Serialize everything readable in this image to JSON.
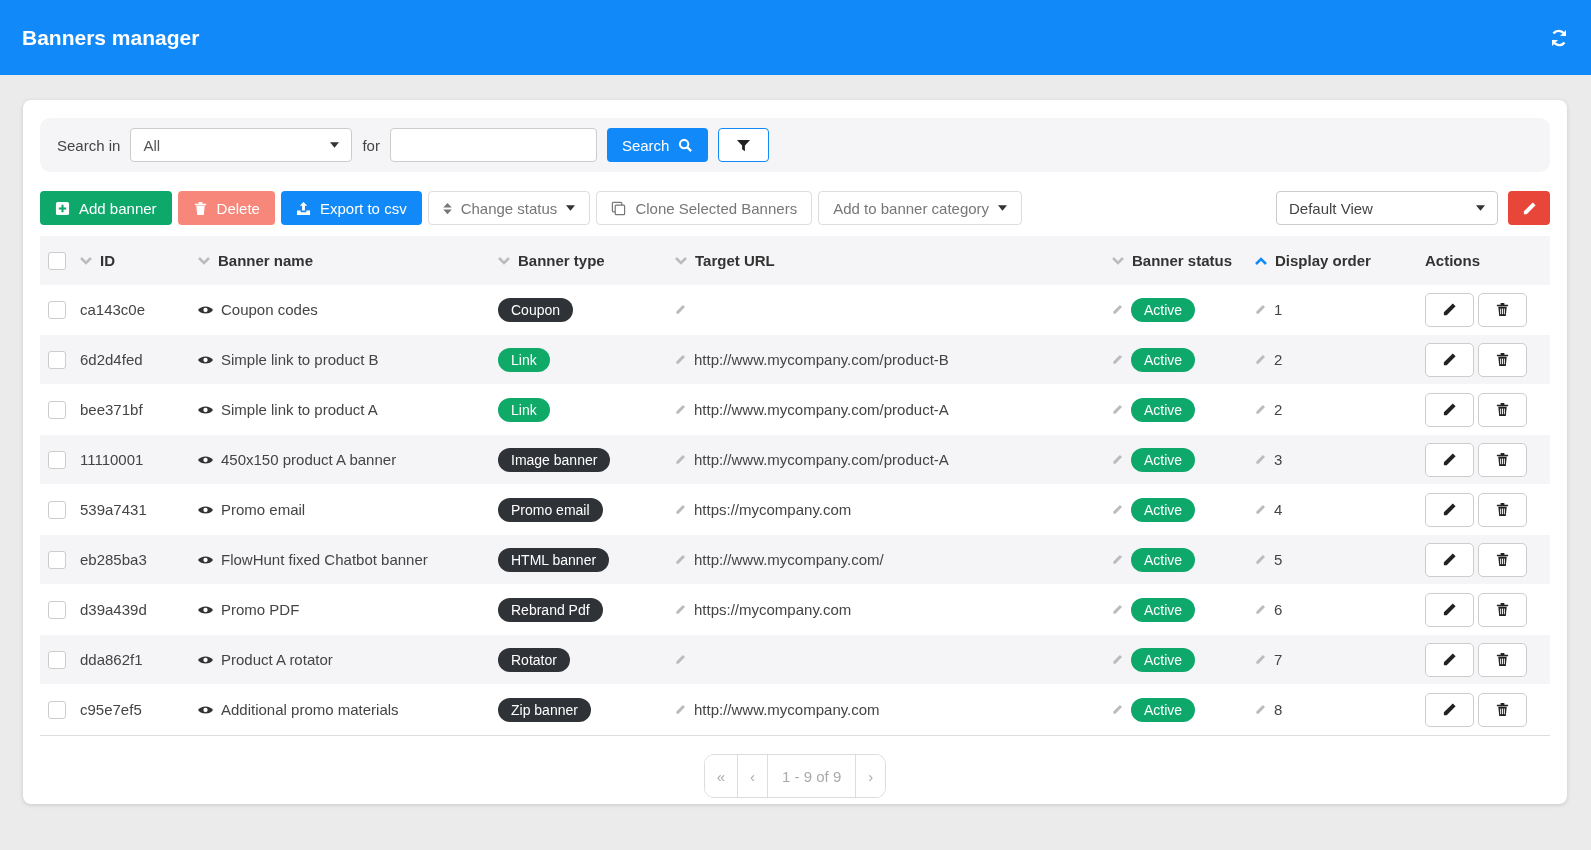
{
  "header": {
    "title": "Banners manager"
  },
  "search": {
    "label": "Search in",
    "scope": "All",
    "for_label": "for",
    "button": "Search"
  },
  "toolbar": {
    "add": "Add banner",
    "delete": "Delete",
    "export": "Export to csv",
    "change_status": "Change status",
    "clone": "Clone Selected Banners",
    "add_category": "Add to banner category",
    "view": "Default View"
  },
  "table": {
    "select_all": false,
    "columns": [
      {
        "label": "ID",
        "sortable": true,
        "sorted": false
      },
      {
        "label": "Banner name",
        "sortable": true,
        "sorted": false
      },
      {
        "label": "Banner type",
        "sortable": true,
        "sorted": false
      },
      {
        "label": "Target URL",
        "sortable": true,
        "sorted": false
      },
      {
        "label": "Banner status",
        "sortable": true,
        "sorted": false
      },
      {
        "label": "Display order",
        "sortable": true,
        "sorted": true
      },
      {
        "label": "Actions",
        "sortable": false,
        "sorted": false
      }
    ],
    "rows": [
      {
        "id": "ca143c0e",
        "name": "Coupon codes",
        "type": "Coupon",
        "color": "#2f3237",
        "url": "",
        "status": "Active",
        "order": "1",
        "checked": false
      },
      {
        "id": "6d2d4fed",
        "name": "Simple link to product B",
        "type": "Link",
        "color": "#0fa968",
        "url": "http://www.mycompany.com/product-B",
        "status": "Active",
        "order": "2",
        "checked": false
      },
      {
        "id": "bee371bf",
        "name": "Simple link to product A",
        "type": "Link",
        "color": "#0fa968",
        "url": "http://www.mycompany.com/product-A",
        "status": "Active",
        "order": "2",
        "checked": false
      },
      {
        "id": "11110001",
        "name": "450x150 product A banner",
        "type": "Image banner",
        "color": "#2f3237",
        "url": "http://www.mycompany.com/product-A",
        "status": "Active",
        "order": "3",
        "checked": false
      },
      {
        "id": "539a7431",
        "name": "Promo email",
        "type": "Promo email",
        "color": "#2f3237",
        "url": "https://mycompany.com",
        "status": "Active",
        "order": "4",
        "checked": false
      },
      {
        "id": "eb285ba3",
        "name": "FlowHunt fixed Chatbot banner",
        "type": "HTML banner",
        "color": "#2f3237",
        "url": "http://www.mycompany.com/",
        "status": "Active",
        "order": "5",
        "checked": false
      },
      {
        "id": "d39a439d",
        "name": "Promo PDF",
        "type": "Rebrand Pdf",
        "color": "#2f3237",
        "url": "https://mycompany.com",
        "status": "Active",
        "order": "6",
        "checked": false
      },
      {
        "id": "dda862f1",
        "name": "Product A rotator",
        "type": "Rotator",
        "color": "#2f3237",
        "url": "",
        "status": "Active",
        "order": "7",
        "checked": false
      },
      {
        "id": "c95e7ef5",
        "name": "Additional promo materials",
        "type": "Zip banner",
        "color": "#2f3237",
        "url": "http://www.mycompany.com",
        "status": "Active",
        "order": "8",
        "checked": false
      }
    ]
  },
  "pagination": {
    "first": "«",
    "prev": "‹",
    "range": "1 - 9 of 9",
    "next": "›"
  }
}
